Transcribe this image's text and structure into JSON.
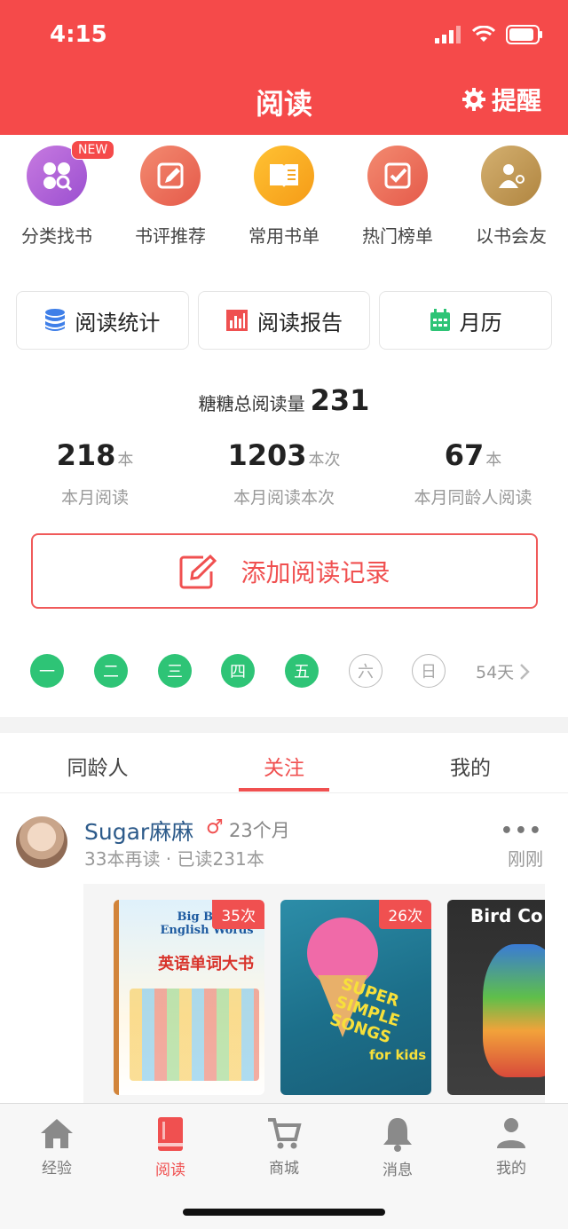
{
  "status": {
    "time": "4:15"
  },
  "header": {
    "title": "阅读",
    "remind_label": "提醒"
  },
  "quick_entries": [
    {
      "label": "分类找书",
      "icon": "category-search-icon",
      "badge": "NEW",
      "color": "#b466d8"
    },
    {
      "label": "书评推荐",
      "icon": "pen-edit-icon",
      "color": "#ef6a55"
    },
    {
      "label": "常用书单",
      "icon": "book-list-icon",
      "color": "#f5a623"
    },
    {
      "label": "热门榜单",
      "icon": "checkbox-icon",
      "color": "#ef6a55"
    },
    {
      "label": "以书会友",
      "icon": "friend-icon",
      "color": "#c29a55"
    }
  ],
  "tools": [
    {
      "label": "阅读统计",
      "icon": "database-icon",
      "color": "#3f7fe8"
    },
    {
      "label": "阅读报告",
      "icon": "report-chart-icon",
      "color": "#ef5050"
    },
    {
      "label": "月历",
      "icon": "calendar-icon",
      "color": "#2ec476"
    }
  ],
  "total": {
    "label": "糖糖总阅读量",
    "value": "231"
  },
  "stats": [
    {
      "value": "218",
      "unit": "本",
      "label": "本月阅读"
    },
    {
      "value": "1203",
      "unit": "本次",
      "label": "本月阅读本次"
    },
    {
      "value": "67",
      "unit": "本",
      "label": "本月同龄人阅读"
    }
  ],
  "add_record": {
    "label": "添加阅读记录"
  },
  "week": {
    "days": [
      {
        "label": "一",
        "done": true
      },
      {
        "label": "二",
        "done": true
      },
      {
        "label": "三",
        "done": true
      },
      {
        "label": "四",
        "done": true
      },
      {
        "label": "五",
        "done": true
      },
      {
        "label": "六",
        "done": false
      },
      {
        "label": "日",
        "done": false
      }
    ],
    "streak": "54天"
  },
  "tabs": [
    {
      "label": "同龄人",
      "active": false
    },
    {
      "label": "关注",
      "active": true
    },
    {
      "label": "我的",
      "active": false
    }
  ],
  "post": {
    "user": "Sugar麻麻",
    "gender_symbol": "♂",
    "age": "23个月",
    "meta": "33本再读 · 已读231本",
    "time": "刚刚",
    "more": "•••",
    "books": [
      {
        "count": "35次",
        "cover_title": "Big Book English Words",
        "cover_subtitle": "英语单词大书"
      },
      {
        "count": "26次",
        "cover_title": "SUPER SIMPLE SONGS",
        "cover_subtitle": "for kids"
      },
      {
        "cover_title": "Bird Co"
      }
    ]
  },
  "bottom_nav": [
    {
      "label": "经验",
      "icon": "home-icon",
      "active": false
    },
    {
      "label": "阅读",
      "icon": "book-icon",
      "active": true
    },
    {
      "label": "商城",
      "icon": "cart-icon",
      "active": false
    },
    {
      "label": "消息",
      "icon": "bell-icon",
      "active": false
    },
    {
      "label": "我的",
      "icon": "user-icon",
      "active": false
    }
  ],
  "colors": {
    "brand": "#f54a4a",
    "accent_green": "#2ec476"
  }
}
